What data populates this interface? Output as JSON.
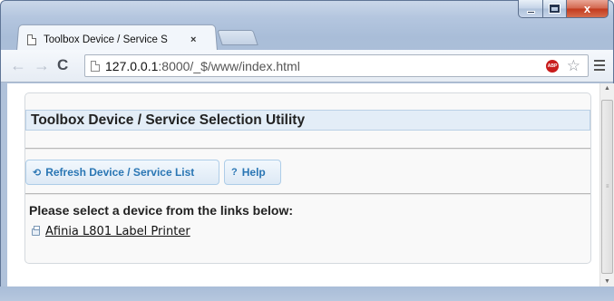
{
  "browser": {
    "tab_title": "Toolbox Device / Service S",
    "tab_close": "×",
    "url_host": "127.0.0.1",
    "url_path": ":8000/_$/www/index.html",
    "abp_label": "ABP",
    "window_close": "x"
  },
  "page": {
    "header": "Toolbox Device / Service Selection Utility",
    "buttons": {
      "refresh_label": "Refresh Device / Service List",
      "help_label": "Help",
      "help_icon": "?"
    },
    "prompt": "Please select a device from the links below:",
    "devices": [
      {
        "label": "Afinia L801 Label Printer"
      }
    ]
  },
  "colors": {
    "accent_blue": "#2a76b4",
    "header_bg": "#e3edf7",
    "close_red": "#c2391d"
  }
}
